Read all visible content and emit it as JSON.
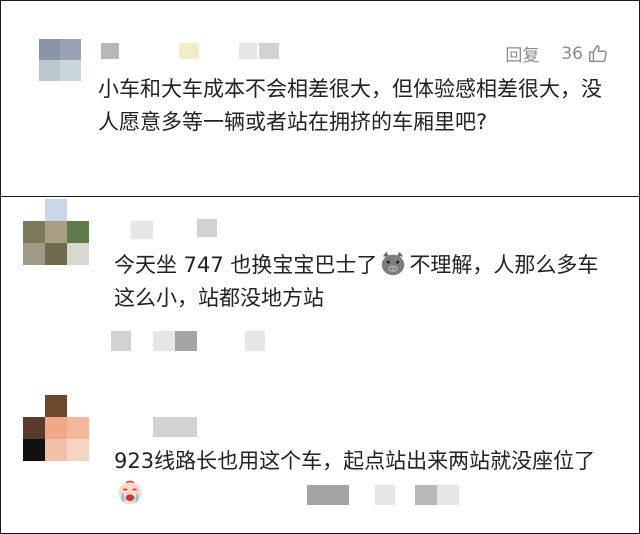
{
  "comments": [
    {
      "actions": {
        "reply_label": "回复",
        "like_count": "36"
      },
      "text": "小车和大车成本不会相差很大，但体验感相差很大，没人愿意多等一辆或者站在拥挤的车厢里吧?"
    },
    {
      "text_before_emoji": "今天坐 747 也换宝宝巴士了",
      "emoji": "pig-face-emoji",
      "text_after_emoji": "不理解，人那么多车这么小，站都没地方站"
    },
    {
      "text_before_emoji": "923线路长也用这个车，起点站出来两站就没座位了",
      "emoji": "crying-face-emoji"
    }
  ],
  "icons": {
    "like": "thumbs-up-icon"
  },
  "colors": {
    "meta_text": "#8c8c8c",
    "body_text": "#222222",
    "border": "#1a1a1a"
  }
}
